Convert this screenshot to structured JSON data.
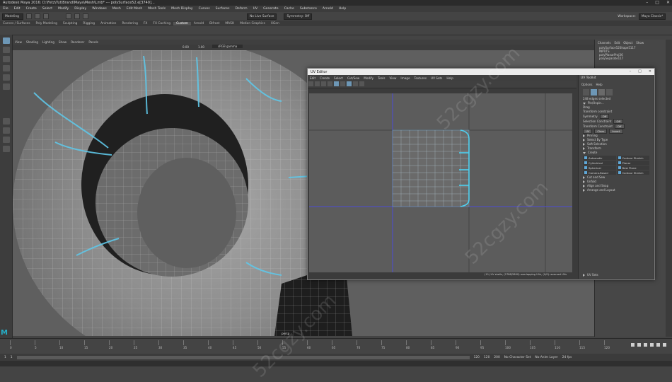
{
  "window": {
    "title": "Autodesk Maya 2016: D:\\Fetz\\Tut\\Brand\\Maya\\Mesh\\Lmb* --- polySurface52.e[3740]..."
  },
  "menubar": [
    "File",
    "Edit",
    "Create",
    "Select",
    "Modify",
    "Display",
    "Windows",
    "Mesh",
    "Edit Mesh",
    "Mesh Tools",
    "Mesh Display",
    "Curves",
    "Surfaces",
    "Deform",
    "UV",
    "Generate",
    "Cache",
    "Substance",
    "Arnold",
    "Help"
  ],
  "statusline": {
    "mode": "Modeling",
    "live_surface": "No Live Surface",
    "symmetry": "Symmetry: Off",
    "workspace_label": "Workspace:",
    "workspace": "Maya Classic*"
  },
  "shelf_tabs": [
    "Curves / Surfaces",
    "Poly Modeling",
    "Sculpting",
    "Rigging",
    "Animation",
    "Rendering",
    "FX",
    "FX Caching",
    "Custom",
    "Arnold",
    "Bifrost",
    "MASH",
    "Motion Graphics",
    "XGen"
  ],
  "shelf_active_index": 8,
  "viewport": {
    "menu": [
      "View",
      "Shading",
      "Lighting",
      "Show",
      "Renderer",
      "Panels"
    ],
    "gamma_value": "0.00",
    "gamma_scale": "1.00",
    "color_space": "sRGB gamma",
    "camera_label": "persp"
  },
  "channel_box": {
    "menu": [
      "Channels",
      "Edit",
      "Object",
      "Show"
    ],
    "items": [
      "polySurface52Shape5117",
      "INPUTS",
      "polyPlanarProj36",
      "polySeparate117"
    ]
  },
  "uv_editor": {
    "title": "UV Editor",
    "menu": [
      "Edit",
      "Create",
      "Select",
      "Cut/Sew",
      "Modify",
      "Tools",
      "View",
      "Image",
      "Textures",
      "UV Sets",
      "Help"
    ],
    "status": "(11) UV shells, (2788/2800) overlapping UVs, (0/0) reversed UVs",
    "uv_space_label": "UV Space"
  },
  "uv_toolkit": {
    "title": "UV Toolkit",
    "menu": [
      "Options",
      "Help"
    ],
    "selection_count": "248 edges selected",
    "pin_label": "Pin/Unpin...",
    "drag_label": "Drag",
    "transform_label": "Transform constraint",
    "symmetry_label": "Symmetry",
    "symmetry_value": "Off",
    "selection_constraint_label": "Selection Constraint",
    "selection_constraint_value": "Off",
    "transform_constraint_label": "Transform Constraint",
    "transform_constraint_value": "Off",
    "buttons": [
      "UV",
      "Clear",
      "Invert"
    ],
    "sections": [
      "Pinning",
      "Select By Type",
      "Soft Selection",
      "Transform"
    ],
    "create_label": "Create",
    "create_items": [
      "Automatic",
      "Contour Stretch",
      "Cylindrical",
      "Planar",
      "Spherical",
      "Best Plane",
      "Camera-Based",
      "Contour Stretch"
    ],
    "sections2": [
      "Cut and Sew",
      "Unfold",
      "Align and Snap",
      "Arrange and Layout"
    ],
    "uv_sets": "UV Sets"
  },
  "timeline": {
    "ticks": [
      "0",
      "5",
      "10",
      "15",
      "20",
      "25",
      "30",
      "35",
      "40",
      "45",
      "50",
      "55",
      "60",
      "65",
      "70",
      "75",
      "80",
      "85",
      "90",
      "95",
      "100",
      "105",
      "110",
      "115",
      "120"
    ]
  },
  "range": {
    "start": "1",
    "start2": "1",
    "end": "120",
    "end2": "120",
    "end3": "200",
    "character_set": "No Character Set",
    "anim_layer": "No Anim Layer",
    "fps": "24 fps"
  },
  "watermark": "52cgzy.com",
  "colors": {
    "uv_accent": "#5fa7d6",
    "maya_logo": "#25b0c9"
  }
}
